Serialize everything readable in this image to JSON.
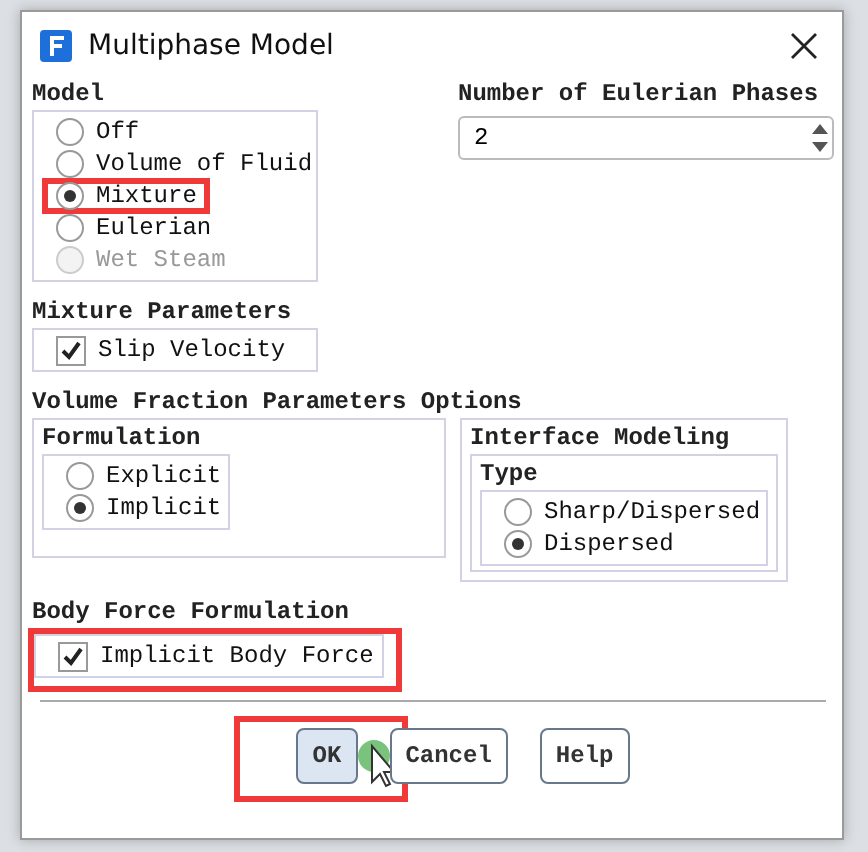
{
  "window": {
    "title": "Multiphase Model"
  },
  "model": {
    "label": "Model",
    "options": [
      {
        "label": "Off",
        "selected": false,
        "disabled": false,
        "highlighted": false
      },
      {
        "label": "Volume of Fluid",
        "selected": false,
        "disabled": false,
        "highlighted": false
      },
      {
        "label": "Mixture",
        "selected": true,
        "disabled": false,
        "highlighted": true
      },
      {
        "label": "Eulerian",
        "selected": false,
        "disabled": false,
        "highlighted": false
      },
      {
        "label": "Wet Steam",
        "selected": false,
        "disabled": true,
        "highlighted": false
      }
    ]
  },
  "phases": {
    "label": "Number of Eulerian Phases",
    "value": "2"
  },
  "mixture_parameters": {
    "label": "Mixture Parameters",
    "checkboxes": [
      {
        "label": "Slip Velocity",
        "checked": true
      }
    ]
  },
  "volume_fraction": {
    "label": "Volume Fraction Parameters Options",
    "formulation": {
      "label": "Formulation",
      "options": [
        {
          "label": "Explicit",
          "selected": false
        },
        {
          "label": "Implicit",
          "selected": true
        }
      ]
    },
    "interface_modeling": {
      "label": "Interface Modeling",
      "type": {
        "label": "Type",
        "options": [
          {
            "label": "Sharp/Dispersed",
            "selected": false
          },
          {
            "label": "Dispersed",
            "selected": true
          }
        ]
      }
    }
  },
  "body_force": {
    "label": "Body Force Formulation",
    "highlighted": true,
    "checkboxes": [
      {
        "label": "Implicit Body Force",
        "checked": true
      }
    ]
  },
  "buttons": [
    {
      "label": "OK",
      "default": true,
      "highlighted": true
    },
    {
      "label": "Cancel",
      "default": false,
      "highlighted": false
    },
    {
      "label": "Help",
      "default": false,
      "highlighted": false
    }
  ]
}
